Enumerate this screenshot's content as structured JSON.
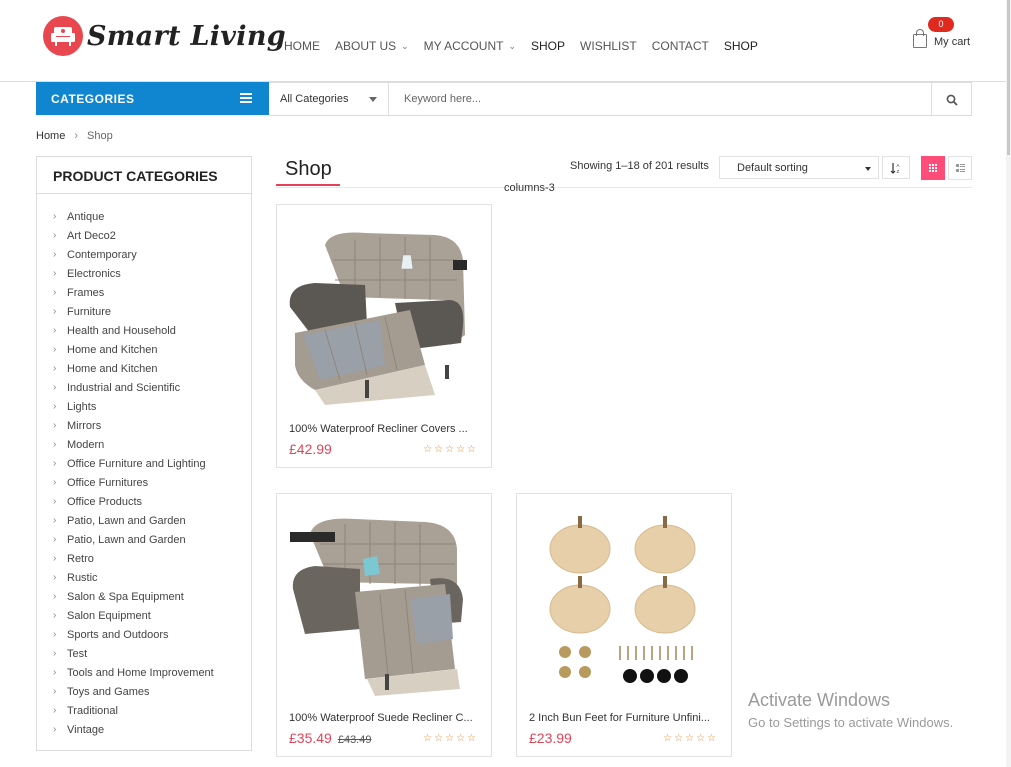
{
  "logo": {
    "text": "Smart Living"
  },
  "nav": [
    {
      "label": "HOME",
      "dropdown": false
    },
    {
      "label": "ABOUT US",
      "dropdown": true
    },
    {
      "label": "MY ACCOUNT",
      "dropdown": true
    },
    {
      "label": "SHOP",
      "dropdown": false
    },
    {
      "label": "WISHLIST",
      "dropdown": false
    },
    {
      "label": "CONTACT",
      "dropdown": false
    },
    {
      "label": "SHOP",
      "dropdown": false
    }
  ],
  "cart": {
    "count": "0",
    "label": "My cart",
    "icon": "shopping-bag-icon"
  },
  "category_bar": {
    "label": "CATEGORIES",
    "icon": "hamburger-menu-icon",
    "color": "#0f86cf"
  },
  "search": {
    "category": "All Categories",
    "placeholder": "Keyword here...",
    "icon": "search-icon"
  },
  "breadcrumb": {
    "home": "Home",
    "separator": "›",
    "current": "Shop"
  },
  "sidebar": {
    "title": "PRODUCT CATEGORIES",
    "items": [
      "Antique",
      "Art Deco2",
      "Contemporary",
      "Electronics",
      "Frames",
      "Furniture",
      "Health and Household",
      "Home and Kitchen",
      "Home and Kitchen",
      "Industrial and Scientific",
      "Lights",
      "Mirrors",
      "Modern",
      "Office Furniture and Lighting",
      "Office Furnitures",
      "Office Products",
      "Patio, Lawn and Garden",
      "Patio, Lawn and Garden",
      "Retro",
      "Rustic",
      "Salon & Spa Equipment",
      "Salon Equipment",
      "Sports and Outdoors",
      "Test",
      "Tools and Home Improvement",
      "Toys and Games",
      "Traditional",
      "Vintage"
    ]
  },
  "shop": {
    "title": "Shop",
    "results": "Showing 1–18 of 201 results",
    "sort": "Default sorting",
    "sort_dir_icon": "sort-icon",
    "columns_note": "columns-3",
    "accent": "#e6405a"
  },
  "products": [
    {
      "name": "100% Waterproof Recliner Covers ...",
      "price": "£42.99",
      "old_price": "",
      "stars": "☆☆☆☆☆",
      "image": "recliner-cover-image"
    },
    {
      "name": "100% Waterproof Suede Recliner C...",
      "price": "£35.49",
      "old_price": "£43.49",
      "stars": "☆☆☆☆☆",
      "image": "recliner-cover-image"
    },
    {
      "name": "2 Inch Bun Feet for Furniture Unfini...",
      "price": "£23.99",
      "old_price": "",
      "stars": "☆☆☆☆☆",
      "image": "bun-feet-image"
    }
  ],
  "watermark": {
    "title": "Activate Windows",
    "subtitle": "Go to Settings to activate Windows."
  }
}
